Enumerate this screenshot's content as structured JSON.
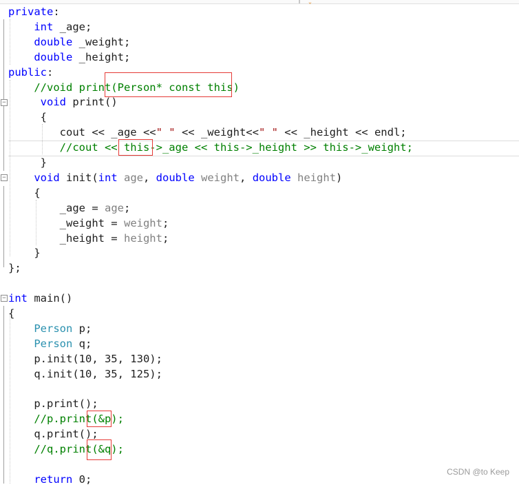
{
  "code_lines": [
    {
      "t": "private:"
    },
    {
      "t": "    int _age;"
    },
    {
      "t": "    double _weight;"
    },
    {
      "t": "    double _height;"
    },
    {
      "t": "public:"
    },
    {
      "t": "    //void print(Person* const this)"
    },
    {
      "t": "     void print()"
    },
    {
      "t": "     {"
    },
    {
      "t": "        cout << _age <<\" \" << _weight<<\" \" << _height << endl;"
    },
    {
      "t": "        //cout << this->_age << this->_height >> this->_weight;"
    },
    {
      "t": "     }"
    },
    {
      "t": "    void init(int age, double weight, double height)"
    },
    {
      "t": "    {"
    },
    {
      "t": "        _age = age;"
    },
    {
      "t": "        _weight = weight;"
    },
    {
      "t": "        _height = height;"
    },
    {
      "t": "    }"
    },
    {
      "t": "};"
    },
    {
      "t": ""
    },
    {
      "t": "int main()"
    },
    {
      "t": "{"
    },
    {
      "t": "    Person p;"
    },
    {
      "t": "    Person q;"
    },
    {
      "t": "    p.init(10, 35, 130);"
    },
    {
      "t": "    q.init(10, 35, 125);"
    },
    {
      "t": ""
    },
    {
      "t": "    p.print();"
    },
    {
      "t": "    //p.print(&p);"
    },
    {
      "t": "    q.print();"
    },
    {
      "t": "    //q.print(&q);"
    },
    {
      "t": ""
    },
    {
      "t": "    return 0;"
    }
  ],
  "fold_markers": [
    "−",
    "−",
    "−"
  ],
  "watermark": "CSDN @to Keep",
  "colors": {
    "keyword": "#0000ff",
    "type": "#2b91af",
    "comment": "#008000",
    "parameter": "#808080",
    "string": "#a31515",
    "annotation_box": "#e53935"
  }
}
